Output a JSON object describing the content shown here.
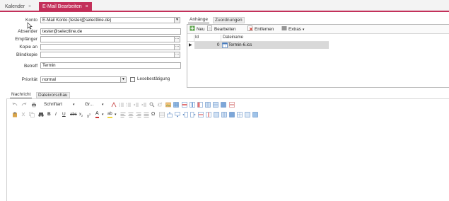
{
  "tabs": [
    {
      "label": "Kalender",
      "close": "×"
    },
    {
      "label": "E-Mail Bearbeiten",
      "close": "×"
    }
  ],
  "form": {
    "konto_label": "Konto",
    "konto_value": "E-Mail Konto (tester@selectline.de)",
    "absender_label": "Absender",
    "absender_value": "tester@selectline.de",
    "empfaenger_label": "Empfänger",
    "empfaenger_value": "",
    "kopie_label": "Kopie an",
    "kopie_value": "",
    "blindkopie_label": "Blindkopie",
    "blindkopie_value": "",
    "betreff_label": "Betreff",
    "betreff_value": "Termin",
    "prioritaet_label": "Priorität",
    "prioritaet_value": "normal",
    "lesebestaetigung_label": "Lesebestätigung",
    "dots": "..."
  },
  "attachments": {
    "tab_anhaenge": "Anhänge",
    "tab_zuordnungen": "Zuordnungen",
    "toolbar": {
      "neu": "Neu",
      "bearbeiten": "Bearbeiten",
      "entfernen": "Entfernen",
      "extras": "Extras"
    },
    "columns": {
      "id": "Id",
      "dateiname": "Dateiname"
    },
    "rows": [
      {
        "id": "0",
        "dateiname": "Termin-6.ics"
      }
    ]
  },
  "editor": {
    "tab_nachricht": "Nachricht",
    "tab_dateivorschau": "Dateivorschau",
    "font_name": "Schriftart",
    "font_size": "Gr..."
  },
  "colors": {
    "accent": "#c3305a"
  }
}
